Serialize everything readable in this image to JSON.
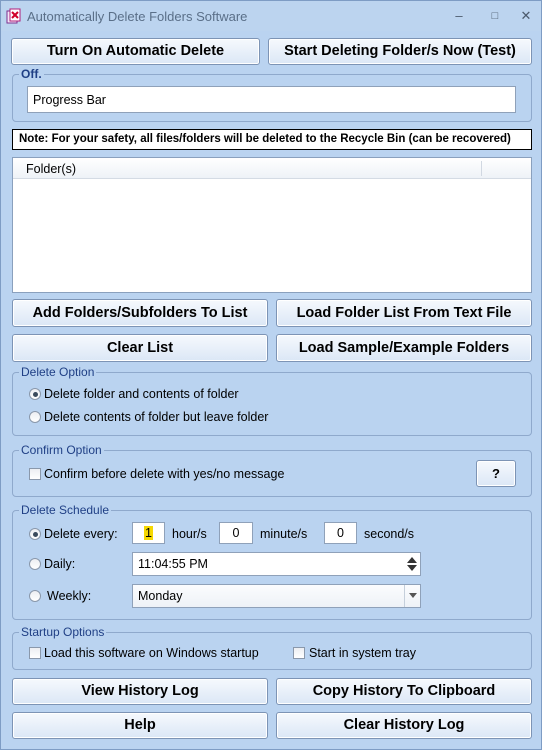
{
  "window": {
    "title": "Automatically Delete Folders Software",
    "minimize": "–",
    "maximize": "□",
    "close": "✕"
  },
  "toolbar": {
    "auto_delete": "Turn On Automatic Delete",
    "delete_now": "Start Deleting Folder/s Now (Test)"
  },
  "status": {
    "legend": "Off.",
    "progress": "Progress Bar"
  },
  "note": "Note: For your safety, all files/folders will be deleted to the Recycle Bin (can be recovered)",
  "folders": {
    "column": "Folder(s)"
  },
  "list_buttons": {
    "add": "Add Folders/Subfolders To List",
    "load_file": "Load Folder List From Text File",
    "clear": "Clear List",
    "load_sample": "Load Sample/Example Folders"
  },
  "delete_option": {
    "legend": "Delete Option",
    "opt1": "Delete folder and contents of folder",
    "opt2": "Delete contents of folder but leave folder"
  },
  "confirm_option": {
    "legend": "Confirm Option",
    "checkbox": "Confirm before delete with yes/no message",
    "help": "?"
  },
  "schedule": {
    "legend": "Delete Schedule",
    "every_label": "Delete every:",
    "hours": "1",
    "hours_unit": "hour/s",
    "minutes": "0",
    "minutes_unit": "minute/s",
    "seconds": "0",
    "seconds_unit": "second/s",
    "daily_label": "Daily:",
    "daily_time": "11:04:55 PM",
    "weekly_label": "Weekly:",
    "weekly_day": "Monday"
  },
  "startup": {
    "legend": "Startup Options",
    "load_startup": "Load this software on Windows startup",
    "tray": "Start in system tray"
  },
  "bottom": {
    "view_history": "View History Log",
    "copy_history": "Copy History To Clipboard",
    "help": "Help",
    "clear_history": "Clear History Log"
  },
  "icons": {
    "app": "app-icon",
    "up": "arrow-up-icon",
    "down": "arrow-down-icon",
    "dropdown": "chevron-down-icon"
  },
  "colors": {
    "accent": "#1f3f85",
    "background": "#bad3f0"
  }
}
